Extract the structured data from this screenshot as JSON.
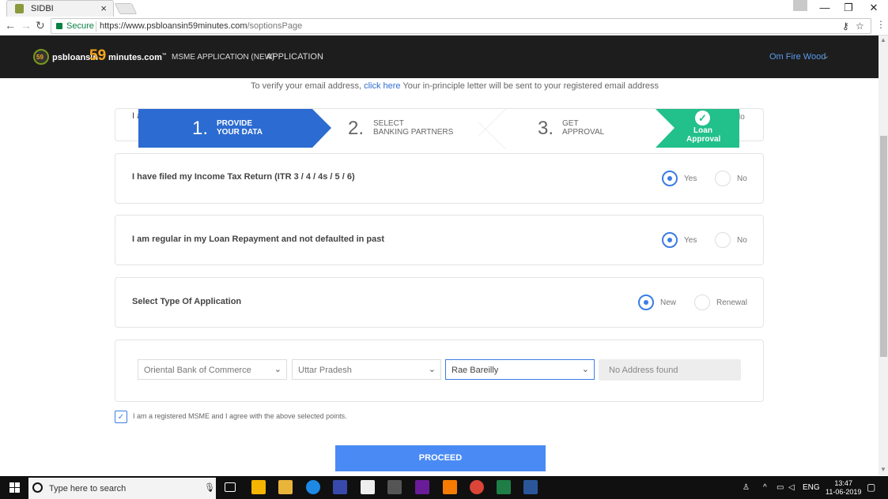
{
  "browser": {
    "tab_title": "SIDBI",
    "tab_close": "×",
    "secure_label": "Secure",
    "url_host": "https://www.psbloansin59minutes.com",
    "url_path": "/soptionsPage"
  },
  "header": {
    "logo_badge": "59",
    "logo_prefix": "psbloansin",
    "logo_number": "59",
    "logo_suffix": "minutes.com",
    "logo_tm": "™",
    "menu_msme": "MSME APPLICATION (NEW)",
    "menu_application": "APPLICATION",
    "user_name": "Om Fire Wood"
  },
  "verify": {
    "before": "To verify your email address,",
    "link": "click here",
    "after": "Your in-principle letter will be sent to your registered email address"
  },
  "stepper": {
    "step1_num": "1.",
    "step1_line1": "PROVIDE",
    "step1_line2": "YOUR DATA",
    "step2_num": "2.",
    "step2_line1": "SELECT",
    "step2_line2": "BANKING PARTNERS",
    "step3_num": "3.",
    "step3_line1": "GET",
    "step3_line2": "APPROVAL",
    "step4_line1": "Loan",
    "step4_line2": "Approval",
    "hidden_left": "I a",
    "hidden_right": "lo"
  },
  "questions": {
    "itr": {
      "text": "I have filed my Income Tax Return (ITR 3 / 4 / 4s / 5 / 6)",
      "yes": "Yes",
      "no": "No",
      "selected": "Yes"
    },
    "repayment": {
      "text": "I am regular in my Loan Repayment and not defaulted in past",
      "yes": "Yes",
      "no": "No",
      "selected": "Yes"
    },
    "app_type": {
      "text": "Select Type Of Application",
      "new": "New",
      "renewal": "Renewal",
      "selected": "New"
    }
  },
  "bank_select": {
    "bank": "Oriental Bank of Commerce",
    "state": "Uttar Pradesh",
    "city": "Rae Bareilly",
    "address": "No Address found"
  },
  "agreement": {
    "label": "I am a registered MSME and I agree with the above selected points.",
    "checked": true
  },
  "proceed_label": "PROCEED",
  "taskbar": {
    "search_placeholder": "Type here to search",
    "lang": "ENG",
    "time": "13:47",
    "date": "11-06-2019"
  },
  "colors": {
    "header_bg": "#1d1d1d",
    "step_active": "#2c6bd1",
    "step_done": "#22c08a",
    "accent": "#3b7de4",
    "proceed": "#4a8af4",
    "logo_orange": "#f7a51a"
  }
}
